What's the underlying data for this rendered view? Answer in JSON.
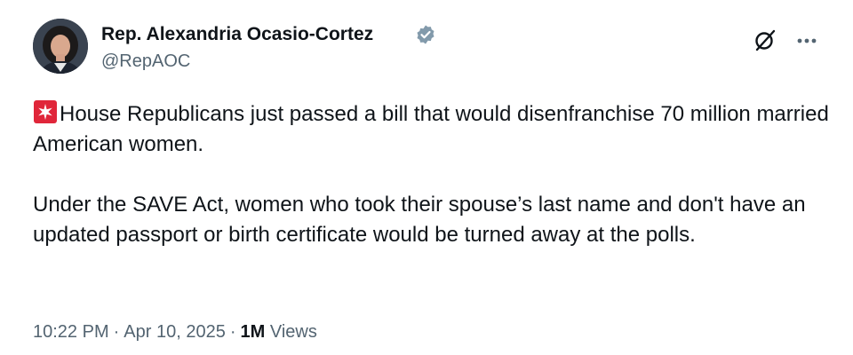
{
  "author": {
    "name": "Rep. Alexandria Ocasio-Cortez",
    "handle": "@RepAOC",
    "verified_color": "#829aab"
  },
  "icons": {
    "avatar": "profile-photo",
    "verified": "verified-badge-icon",
    "grok": "grok-icon",
    "more": "more-icon",
    "alert": "rotating-light-emoji"
  },
  "tweet": {
    "paragraph1": "House Republicans just passed a bill that would disenfranchise 70 million married American women.",
    "paragraph2": "Under the SAVE Act, women who took their spouse’s last name and don't have an updated passport or birth certificate would be turned away at the polls."
  },
  "meta": {
    "time": "10:22 PM",
    "date": "Apr 10, 2025",
    "separator": "·",
    "views_count": "1M",
    "views_label": "Views"
  },
  "colors": {
    "text": "#0f1419",
    "secondary": "#536471",
    "alert_red": "#e0263a"
  }
}
